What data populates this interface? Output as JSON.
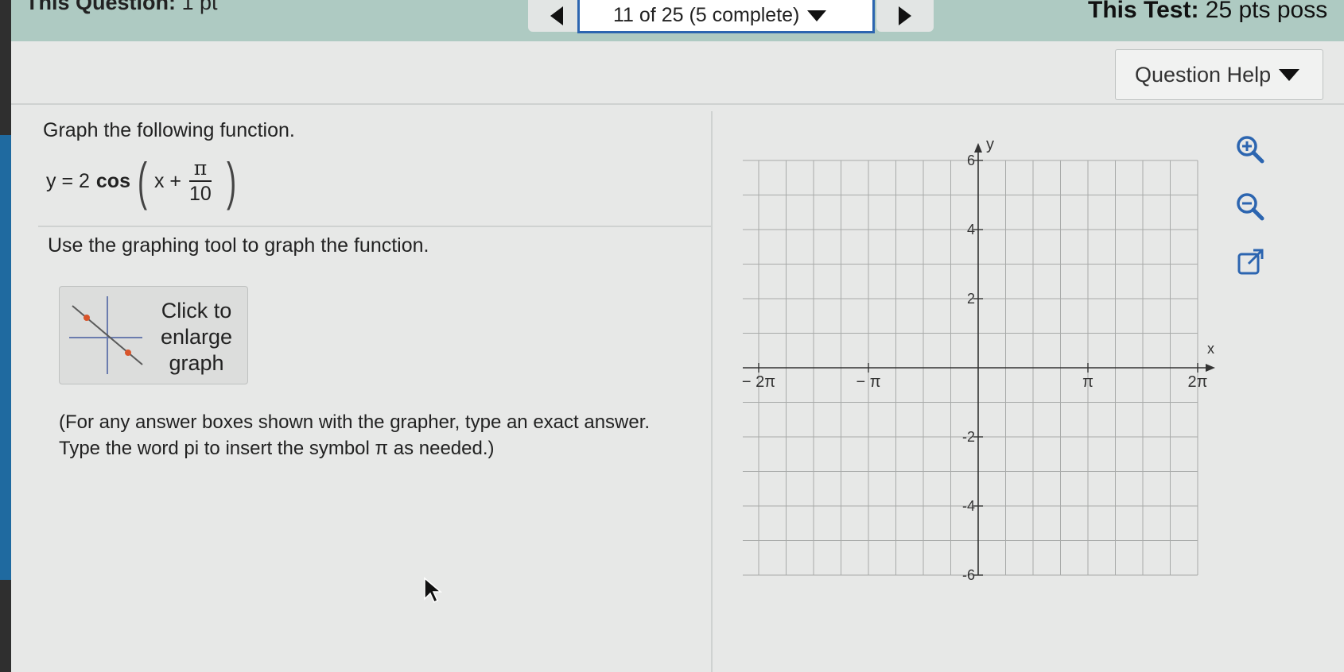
{
  "header": {
    "question_label": "This Question:",
    "question_points": "1 pt",
    "progress": "11 of 25 (5 complete)",
    "test_label": "This Test:",
    "test_points": "25 pts poss"
  },
  "help": {
    "label": "Question Help"
  },
  "question": {
    "prompt": "Graph the following function.",
    "equation": {
      "lhs": "y = 2",
      "func": "cos",
      "var": "x +",
      "numerator": "π",
      "denominator": "10"
    },
    "instruction": "Use the graphing tool to graph the function.",
    "enlarge_label": "Click to enlarge graph",
    "note_line1": "(For any answer boxes shown with the grapher, type an exact answer.",
    "note_line2": "Type the word pi to insert the symbol π as needed.)"
  },
  "graph": {
    "x_axis_label": "x",
    "y_axis_label": "y",
    "x_ticks": [
      "− 2π",
      "− π",
      "π",
      "2π"
    ],
    "y_ticks": [
      "6",
      "4",
      "2",
      "-2",
      "-4",
      "-6"
    ],
    "x_range": [
      "-2π",
      "2π"
    ],
    "y_range": [
      -6,
      6
    ],
    "grid": true
  },
  "tools": {
    "zoom_in": "zoom-in-icon",
    "zoom_out": "zoom-out-icon",
    "popout": "popout-icon"
  }
}
